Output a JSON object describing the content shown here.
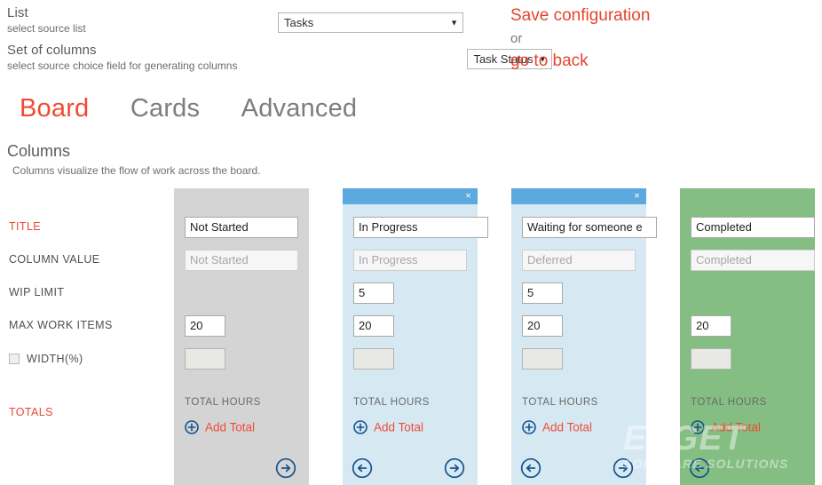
{
  "form": {
    "list_label": "List",
    "list_sub": "select source list",
    "list_value": "Tasks",
    "columns_label": "Set of columns",
    "columns_sub": "select source choice field for generating columns",
    "columns_value": "Task Status"
  },
  "actions": {
    "save": "Save configuration",
    "or": "or",
    "back": "go to back"
  },
  "tabs": [
    {
      "label": "Board"
    },
    {
      "label": "Cards"
    },
    {
      "label": "Advanced"
    }
  ],
  "section": {
    "title": "Columns",
    "subtitle": "Columns visualize the flow of work across the board."
  },
  "row_labels": {
    "title": "TITLE",
    "column_value": "COLUMN VALUE",
    "wip_limit": "WIP LIMIT",
    "max_work_items": "MAX WORK ITEMS",
    "width": "WIDTH(%)",
    "totals": "TOTALS"
  },
  "common": {
    "total_hours": "TOTAL HOURS",
    "add_total": "Add Total",
    "close_glyph": "×"
  },
  "colors": {
    "accent_red": "#ef4b34",
    "header_blue": "#5ba9de",
    "body_blue": "#d6e9f3",
    "body_gray": "#d4d4d4",
    "body_green": "#85be82",
    "nav_blue": "#14538c"
  },
  "columns": [
    {
      "title": "Not Started",
      "column_value": "Not Started",
      "wip_limit": "",
      "max_work_items": "20",
      "width": "",
      "has_wip": false,
      "has_close": false,
      "has_prev": false,
      "has_next": true,
      "total_hours": "TOTAL HOURS",
      "add_total": "Add Total"
    },
    {
      "title": "In Progress",
      "column_value": "In Progress",
      "wip_limit": "5",
      "max_work_items": "20",
      "width": "",
      "has_wip": true,
      "has_close": true,
      "has_prev": true,
      "has_next": true,
      "total_hours": "TOTAL HOURS",
      "add_total": "Add Total"
    },
    {
      "title": "Waiting for someone e",
      "column_value": "Deferred",
      "wip_limit": "5",
      "max_work_items": "20",
      "width": "",
      "has_wip": true,
      "has_close": true,
      "has_prev": true,
      "has_next": true,
      "total_hours": "TOTAL HOURS",
      "add_total": "Add Total"
    },
    {
      "title": "Completed",
      "column_value": "Completed",
      "wip_limit": "",
      "max_work_items": "20",
      "width": "",
      "has_wip": false,
      "has_close": false,
      "has_prev": true,
      "has_next": false,
      "total_hours": "TOTAL HOURS",
      "add_total": "Add Total"
    }
  ],
  "watermark": {
    "brand": "EVGET",
    "tagline": "SOFTWARE SOLUTIONS"
  }
}
